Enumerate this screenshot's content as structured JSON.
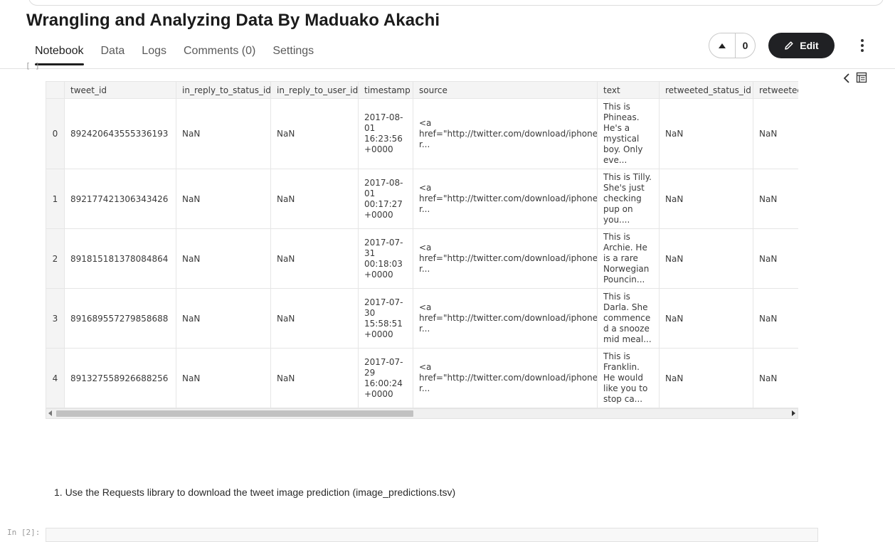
{
  "notebook": {
    "title": "Wrangling and Analyzing Data By Maduako Akachi",
    "tabs": [
      {
        "label": "Notebook",
        "active": true
      },
      {
        "label": "Data"
      },
      {
        "label": "Logs"
      },
      {
        "label": "Comments (0)"
      },
      {
        "label": "Settings"
      }
    ],
    "vote_count": "0",
    "edit_label": "Edit",
    "icons": {
      "upvote": "triangle-up-icon",
      "edit": "pencil-icon",
      "more": "kebab-menu-icon",
      "collapse": "chevron-left-icon",
      "toc": "table-of-contents-icon"
    }
  },
  "output_prompt": "[ ]",
  "dataframe": {
    "columns": [
      "",
      "tweet_id",
      "in_reply_to_status_id",
      "in_reply_to_user_id",
      "timestamp",
      "source",
      "text",
      "retweeted_status_id",
      "retweetec"
    ],
    "rows": [
      {
        "idx": "0",
        "tweet_id": "892420643555336193",
        "in_reply_to_status_id": "NaN",
        "in_reply_to_user_id": "NaN",
        "timestamp": "2017-08-01 16:23:56 +0000",
        "source": "<a href=\"http://twitter.com/download/iphone\" r...",
        "text": "This is Phineas. He's a mystical boy. Only eve...",
        "retweeted_status_id": "NaN",
        "retweeted_status_user_id": "NaN"
      },
      {
        "idx": "1",
        "tweet_id": "892177421306343426",
        "in_reply_to_status_id": "NaN",
        "in_reply_to_user_id": "NaN",
        "timestamp": "2017-08-01 00:17:27 +0000",
        "source": "<a href=\"http://twitter.com/download/iphone\" r...",
        "text": "This is Tilly. She's just checking pup on you....",
        "retweeted_status_id": "NaN",
        "retweeted_status_user_id": "NaN"
      },
      {
        "idx": "2",
        "tweet_id": "891815181378084864",
        "in_reply_to_status_id": "NaN",
        "in_reply_to_user_id": "NaN",
        "timestamp": "2017-07-31 00:18:03 +0000",
        "source": "<a href=\"http://twitter.com/download/iphone\" r...",
        "text": "This is Archie. He is a rare Norwegian Pouncin...",
        "retweeted_status_id": "NaN",
        "retweeted_status_user_id": "NaN"
      },
      {
        "idx": "3",
        "tweet_id": "891689557279858688",
        "in_reply_to_status_id": "NaN",
        "in_reply_to_user_id": "NaN",
        "timestamp": "2017-07-30 15:58:51 +0000",
        "source": "<a href=\"http://twitter.com/download/iphone\" r...",
        "text": "This is Darla. She commenced a snooze mid meal...",
        "retweeted_status_id": "NaN",
        "retweeted_status_user_id": "NaN"
      },
      {
        "idx": "4",
        "tweet_id": "891327558926688256",
        "in_reply_to_status_id": "NaN",
        "in_reply_to_user_id": "NaN",
        "timestamp": "2017-07-29 16:00:24 +0000",
        "source": "<a href=\"http://twitter.com/download/iphone\" r...",
        "text": "This is Franklin. He would like you to stop ca...",
        "retweeted_status_id": "NaN",
        "retweeted_status_user_id": "NaN"
      }
    ]
  },
  "markdown": {
    "step_text": "1. Use the Requests library to download the tweet image prediction (image_predictions.tsv)"
  },
  "next_cell_prompt": "In [2]:"
}
